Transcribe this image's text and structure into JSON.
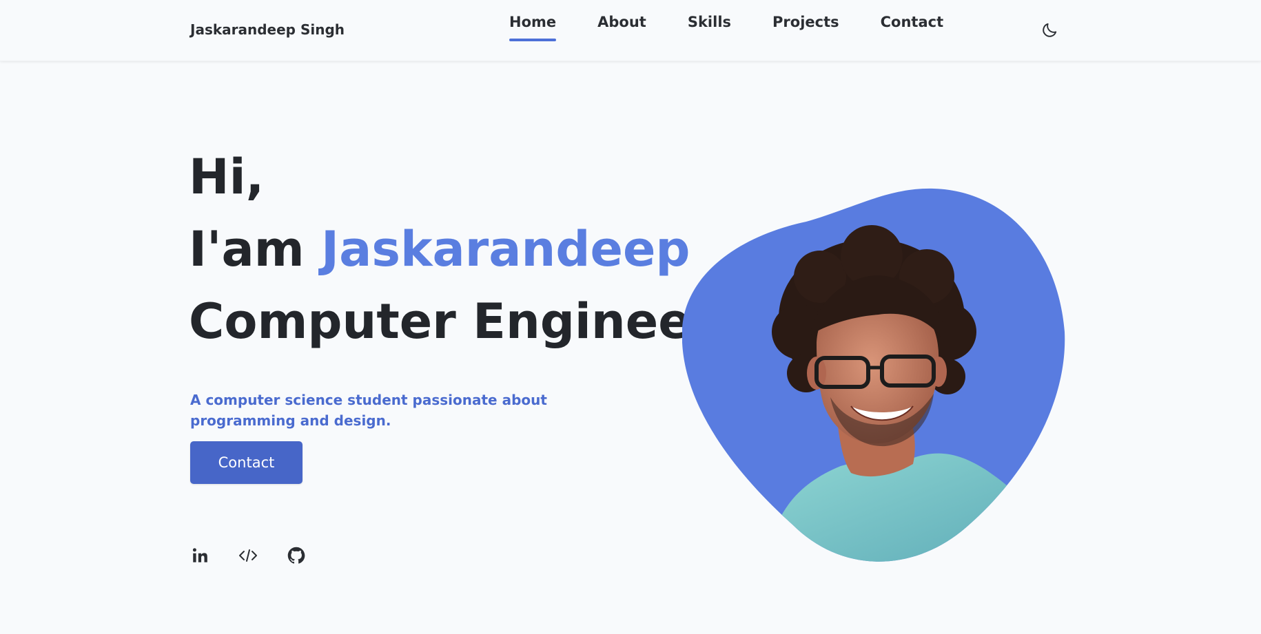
{
  "brand": {
    "name": "Jaskarandeep Singh"
  },
  "nav": {
    "items": [
      {
        "label": "Home",
        "active": true
      },
      {
        "label": "About",
        "active": false
      },
      {
        "label": "Skills",
        "active": false
      },
      {
        "label": "Projects",
        "active": false
      },
      {
        "label": "Contact",
        "active": false
      }
    ]
  },
  "theme_toggle": {
    "icon": "moon-icon"
  },
  "hero": {
    "greeting": "Hi,",
    "intro_prefix": "I'am ",
    "name": "Jaskarandeep",
    "role": "Computer Engineer",
    "subtitle": "A computer science student passionate about programming and design.",
    "cta_label": "Contact"
  },
  "socials": [
    {
      "icon": "linkedin-icon"
    },
    {
      "icon": "code-icon"
    },
    {
      "icon": "github-icon"
    }
  ],
  "colors": {
    "accent": "#5a7ee0",
    "button": "#4766c8",
    "subtitle": "#4a6bcf",
    "blob": "#597ce0",
    "background": "#f8fafc",
    "text": "#23262b"
  }
}
